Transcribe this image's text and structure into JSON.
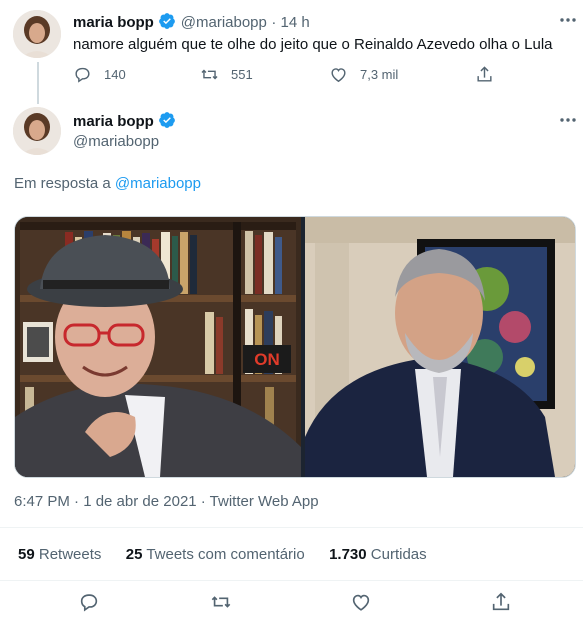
{
  "parent_tweet": {
    "display_name": "maria bopp",
    "handle": "@mariabopp",
    "time": "· 14 h",
    "text": "namore alguém que te olhe do jeito que o Reinaldo Azevedo olha o Lula",
    "replies": "140",
    "retweets": "551",
    "likes": "7,3 mil"
  },
  "main_tweet": {
    "display_name": "maria bopp",
    "handle": "@mariabopp",
    "reply_prefix": "Em resposta a",
    "reply_to": "@mariabopp",
    "media_sign": "ON",
    "timestamp": "6:47 PM · 1 de abr de 2021 · Twitter Web App",
    "stats": {
      "retweets_count": "59",
      "retweets_label": "Retweets",
      "comments_count": "25",
      "comments_label": "Tweets com comentário",
      "likes_count": "1.730",
      "likes_label": "Curtidas"
    }
  },
  "colors": {
    "accent": "#1d9bf0",
    "text_primary": "#0f1419",
    "text_secondary": "#536471",
    "divider": "#eff3f4"
  },
  "icons": [
    "more-icon",
    "verified-badge-icon",
    "reply-icon",
    "retweet-icon",
    "like-icon",
    "share-icon"
  ]
}
